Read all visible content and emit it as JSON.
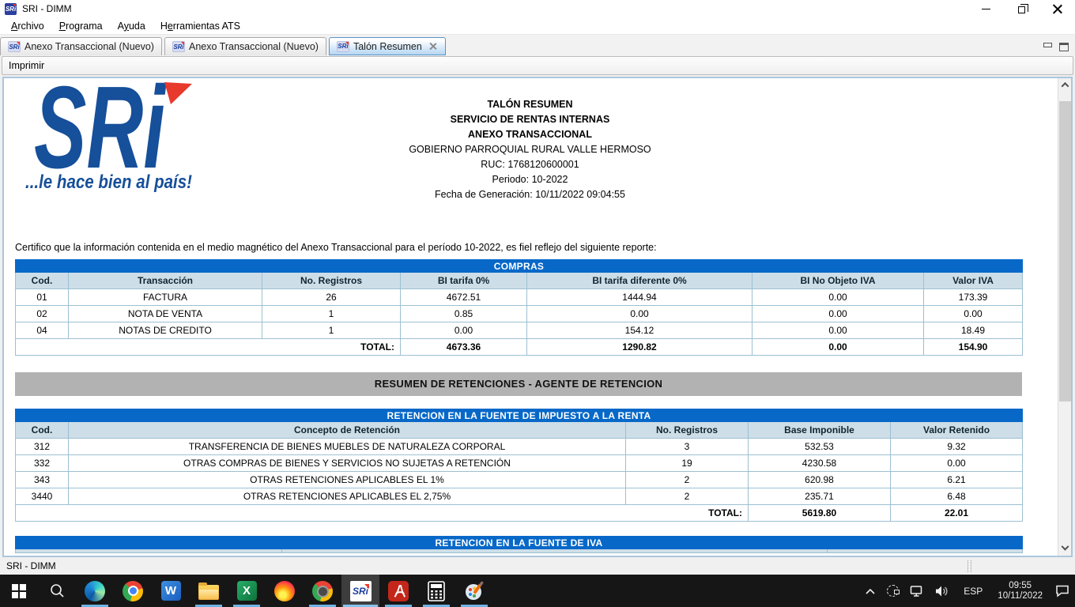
{
  "titlebar": {
    "title": "SRI - DIMM"
  },
  "menu": {
    "items": [
      {
        "pre": "",
        "key": "A",
        "post": "rchivo"
      },
      {
        "pre": "",
        "key": "P",
        "post": "rograma"
      },
      {
        "pre": "A",
        "key": "y",
        "post": "uda"
      },
      {
        "pre": "H",
        "key": "e",
        "post": "rramientas ATS"
      }
    ]
  },
  "tabs": {
    "tab1": "Anexo Transaccional (Nuevo)",
    "tab2": "Anexo Transaccional (Nuevo)",
    "tab3": "Talón Resumen"
  },
  "toolbar": {
    "imprimir": "Imprimir"
  },
  "doc": {
    "logo_text": "SRi",
    "logo_tagline": "...le hace bien al país!",
    "h1": "TALÓN RESUMEN",
    "h2": "SERVICIO DE RENTAS INTERNAS",
    "h3": "ANEXO TRANSACCIONAL",
    "h4": "GOBIERNO PARROQUIAL RURAL VALLE HERMOSO",
    "h5": "RUC: 1768120600001",
    "h6": "Periodo: 10-2022",
    "h7": "Fecha de Generación: 10/11/2022 09:04:55",
    "certification": "Certifico que la información contenida en el medio magnético del Anexo Transaccional para el período 10-2022, es fiel reflejo del siguiente reporte:"
  },
  "compras": {
    "title": "COMPRAS",
    "cols": [
      "Cod.",
      "Transacción",
      "No. Registros",
      "BI tarifa 0%",
      "BI tarifa diferente 0%",
      "BI No Objeto IVA",
      "Valor IVA"
    ],
    "rows": [
      [
        "01",
        "FACTURA",
        "26",
        "4672.51",
        "1444.94",
        "0.00",
        "173.39"
      ],
      [
        "02",
        "NOTA DE VENTA",
        "1",
        "0.85",
        "0.00",
        "0.00",
        "0.00"
      ],
      [
        "04",
        "NOTAS DE CREDITO",
        "1",
        "0.00",
        "154.12",
        "0.00",
        "18.49"
      ]
    ],
    "total_label": "TOTAL:",
    "totals": [
      "4673.36",
      "1290.82",
      "0.00",
      "154.90"
    ]
  },
  "section_title": "RESUMEN DE RETENCIONES - AGENTE DE RETENCION",
  "renta": {
    "title": "RETENCION EN LA FUENTE DE IMPUESTO A LA RENTA",
    "cols": [
      "Cod.",
      "Concepto de Retención",
      "No. Registros",
      "Base Imponible",
      "Valor Retenido"
    ],
    "rows": [
      [
        "312",
        "TRANSFERENCIA DE BIENES MUEBLES DE NATURALEZA CORPORAL",
        "3",
        "532.53",
        "9.32"
      ],
      [
        "332",
        "OTRAS COMPRAS DE BIENES Y SERVICIOS NO SUJETAS A RETENCIÓN",
        "19",
        "4230.58",
        "0.00"
      ],
      [
        "343",
        "OTRAS RETENCIONES APLICABLES EL 1%",
        "2",
        "620.98",
        "6.21"
      ],
      [
        "3440",
        "OTRAS RETENCIONES APLICABLES EL 2,75%",
        "2",
        "235.71",
        "6.48"
      ]
    ],
    "total_label": "TOTAL:",
    "totals": [
      "5619.80",
      "22.01"
    ]
  },
  "iva": {
    "title": "RETENCION EN LA FUENTE DE IVA"
  },
  "statusbar": {
    "text": "SRI - DIMM"
  },
  "taskbar": {
    "word_letter": "W",
    "excel_letter": "X",
    "icons": [
      "start-icon",
      "search-icon",
      "edge-icon",
      "chrome-icon",
      "word-icon",
      "explorer-icon",
      "excel-icon",
      "firefox-icon",
      "chrome-profile-icon",
      "sri-icon",
      "acrobat-icon",
      "calculator-icon",
      "paint-icon"
    ],
    "running": [
      "edge",
      "explorer",
      "excel",
      "chrome-profile",
      "sri",
      "acrobat",
      "calculator",
      "paint"
    ]
  },
  "tray": {
    "icons": [
      "chevron-up-icon",
      "dashed-circle-icon",
      "network-icon",
      "volume-icon",
      "action-center-icon"
    ],
    "lang": "ESP",
    "time": "09:55",
    "date": "10/11/2022"
  },
  "colors": {
    "table_title_blue": "#0768c8",
    "table_head_bg": "#cddee8",
    "table_border": "#9cc0d2",
    "section_gray": "#b2b2b2",
    "logo_blue": "#164f9a",
    "logo_red": "#e8392d",
    "active_tab_blue": "#5a94c8",
    "taskbar_bg": "#161616",
    "run_indicator": "#6fb2e4"
  }
}
